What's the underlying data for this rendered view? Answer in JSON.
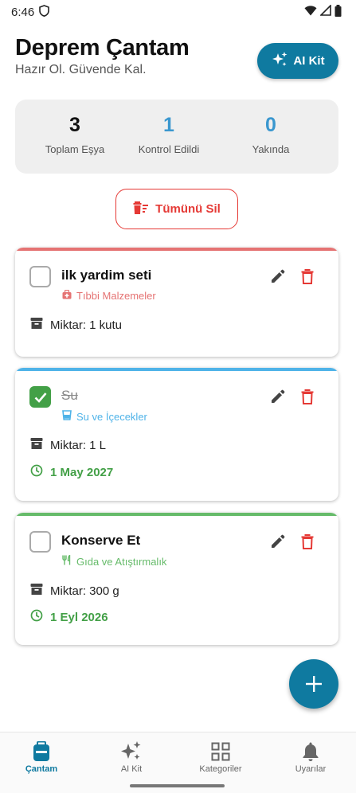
{
  "status_bar": {
    "time": "6:46"
  },
  "header": {
    "title": "Deprem Çantam",
    "subtitle": "Hazır Ol. Güvende Kal.",
    "ai_button_label": "AI Kit"
  },
  "stats": [
    {
      "value": "3",
      "label": "Toplam Eşya",
      "color": "#111111"
    },
    {
      "value": "1",
      "label": "Kontrol Edildi",
      "color": "#3a97cf"
    },
    {
      "value": "0",
      "label": "Yakında",
      "color": "#3a97cf"
    }
  ],
  "delete_all_label": "Tümünü Sil",
  "items": [
    {
      "name": "ilk yardim seti",
      "checked": false,
      "category": "Tıbbi Malzemeler",
      "category_icon": "medical-bag-icon",
      "category_color": "#e57373",
      "quantity": "Miktar: 1 kutu",
      "expiry": null
    },
    {
      "name": "Su",
      "checked": true,
      "category": "Su ve İçecekler",
      "category_icon": "cup-icon",
      "category_color": "#4fb3e8",
      "quantity": "Miktar: 1 L",
      "expiry": "1 May 2027"
    },
    {
      "name": "Konserve Et",
      "checked": false,
      "category": "Gıda ve Atıştırmalık",
      "category_icon": "fork-knife-icon",
      "category_color": "#66bb6a",
      "quantity": "Miktar: 300 g",
      "expiry": "1 Eyl 2026"
    }
  ],
  "nav": [
    {
      "label": "Çantam",
      "icon": "bag-icon",
      "active": true
    },
    {
      "label": "AI Kit",
      "icon": "sparkle-icon",
      "active": false
    },
    {
      "label": "Kategoriler",
      "icon": "grid-icon",
      "active": false
    },
    {
      "label": "Uyarılar",
      "icon": "bell-icon",
      "active": false
    }
  ],
  "colors": {
    "accent": "#0f7aa0",
    "danger": "#e53935",
    "success": "#43a047",
    "expiry_date": "#43a047"
  }
}
